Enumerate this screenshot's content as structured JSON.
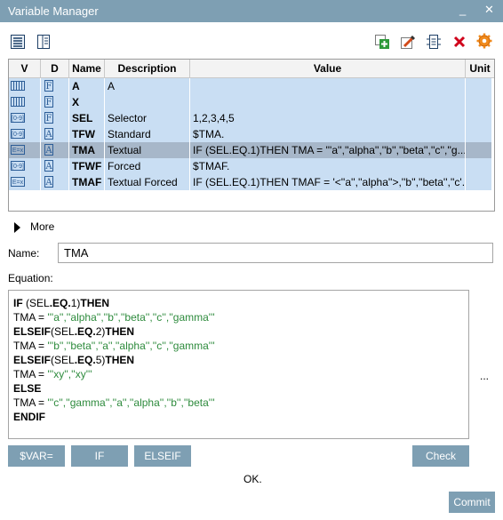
{
  "window": {
    "title": "Variable Manager",
    "minimize": "_",
    "close": "✕"
  },
  "toolbar": {
    "view_list_icon": "list-view-icon",
    "view_detail_icon": "detail-view-icon",
    "add_icon": "add-variable-icon",
    "edit_icon": "edit-variable-icon",
    "copy_icon": "copy-variable-icon",
    "delete_icon": "delete-variable-icon",
    "settings_icon": "settings-gear-icon"
  },
  "table": {
    "columns": [
      "V",
      "D",
      "Name",
      "Description",
      "Value",
      "Unit"
    ],
    "rows": [
      {
        "v": "",
        "d": "F",
        "name": "A",
        "description": "A",
        "value": "",
        "unit": "",
        "selected": false
      },
      {
        "v": "",
        "d": "F",
        "name": "X",
        "description": "",
        "value": "",
        "unit": "",
        "selected": false
      },
      {
        "v": "[0-9]",
        "d": "F",
        "name": "SEL",
        "description": "Selector",
        "value": "1,2,3,4,5",
        "unit": "",
        "selected": false
      },
      {
        "v": "[0-9]",
        "d": "A",
        "name": "TFW",
        "description": "Standard",
        "value": " $TMA.",
        "unit": "",
        "selected": false
      },
      {
        "v": "E=x",
        "d": "A",
        "name": "TMA",
        "description": "Textual",
        "value": "IF (SEL.EQ.1)THEN TMA = '''a'',''alpha'',''b'',''beta'',''c'',''g...",
        "unit": "",
        "selected": true
      },
      {
        "v": "[0-9]",
        "d": "A",
        "name": "TFWF",
        "description": "Forced",
        "value": " $TMAF.",
        "unit": "",
        "selected": false
      },
      {
        "v": "E=x",
        "d": "A",
        "name": "TMAF",
        "description": "Textual Forced",
        "value": "IF (SEL.EQ.1)THEN TMAF = '<''a'',''alpha''>,''b'',''beta'',''c'...",
        "unit": "",
        "selected": false
      }
    ]
  },
  "more": {
    "label": "More"
  },
  "form": {
    "name_label": "Name:",
    "name_value": "TMA",
    "equation_label": "Equation:",
    "equation_lines": [
      [
        {
          "t": "IF",
          "k": "kw"
        },
        {
          "t": " (SEL",
          "k": ""
        },
        {
          "t": ".EQ.",
          "k": "kw"
        },
        {
          "t": "1)",
          "k": ""
        },
        {
          "t": "THEN",
          "k": "kw"
        }
      ],
      [
        {
          "t": " TMA = ",
          "k": ""
        },
        {
          "t": "'''a'',''alpha'',''b'',''beta'',''c'',''gamma'''",
          "k": "str"
        }
      ],
      [
        {
          "t": "ELSEIF",
          "k": "kw"
        },
        {
          "t": "(SEL",
          "k": ""
        },
        {
          "t": ".EQ.",
          "k": "kw"
        },
        {
          "t": "2)",
          "k": ""
        },
        {
          "t": "THEN",
          "k": "kw"
        }
      ],
      [
        {
          "t": " TMA = ",
          "k": ""
        },
        {
          "t": "'''b'',''beta'',''a'',''alpha'',''c'',''gamma'''",
          "k": "str"
        }
      ],
      [
        {
          "t": "ELSEIF",
          "k": "kw"
        },
        {
          "t": "(SEL",
          "k": ""
        },
        {
          "t": ".EQ.",
          "k": "kw"
        },
        {
          "t": "5)",
          "k": ""
        },
        {
          "t": "THEN",
          "k": "kw"
        }
      ],
      [
        {
          "t": " TMA = ",
          "k": ""
        },
        {
          "t": "'''xy'',''xy'''",
          "k": "str"
        }
      ],
      [
        {
          "t": "ELSE",
          "k": "kw"
        }
      ],
      [
        {
          "t": " TMA = ",
          "k": ""
        },
        {
          "t": "'''c'',''gamma'',''a'',''alpha'',''b'',''beta'''",
          "k": "str"
        }
      ],
      [
        {
          "t": "ENDIF",
          "k": "kw"
        }
      ]
    ],
    "more_dots": "..."
  },
  "buttons": {
    "var": "$VAR=",
    "if": "IF",
    "elseif": "ELSEIF",
    "check": "Check",
    "commit": "Commit"
  },
  "status": "OK."
}
